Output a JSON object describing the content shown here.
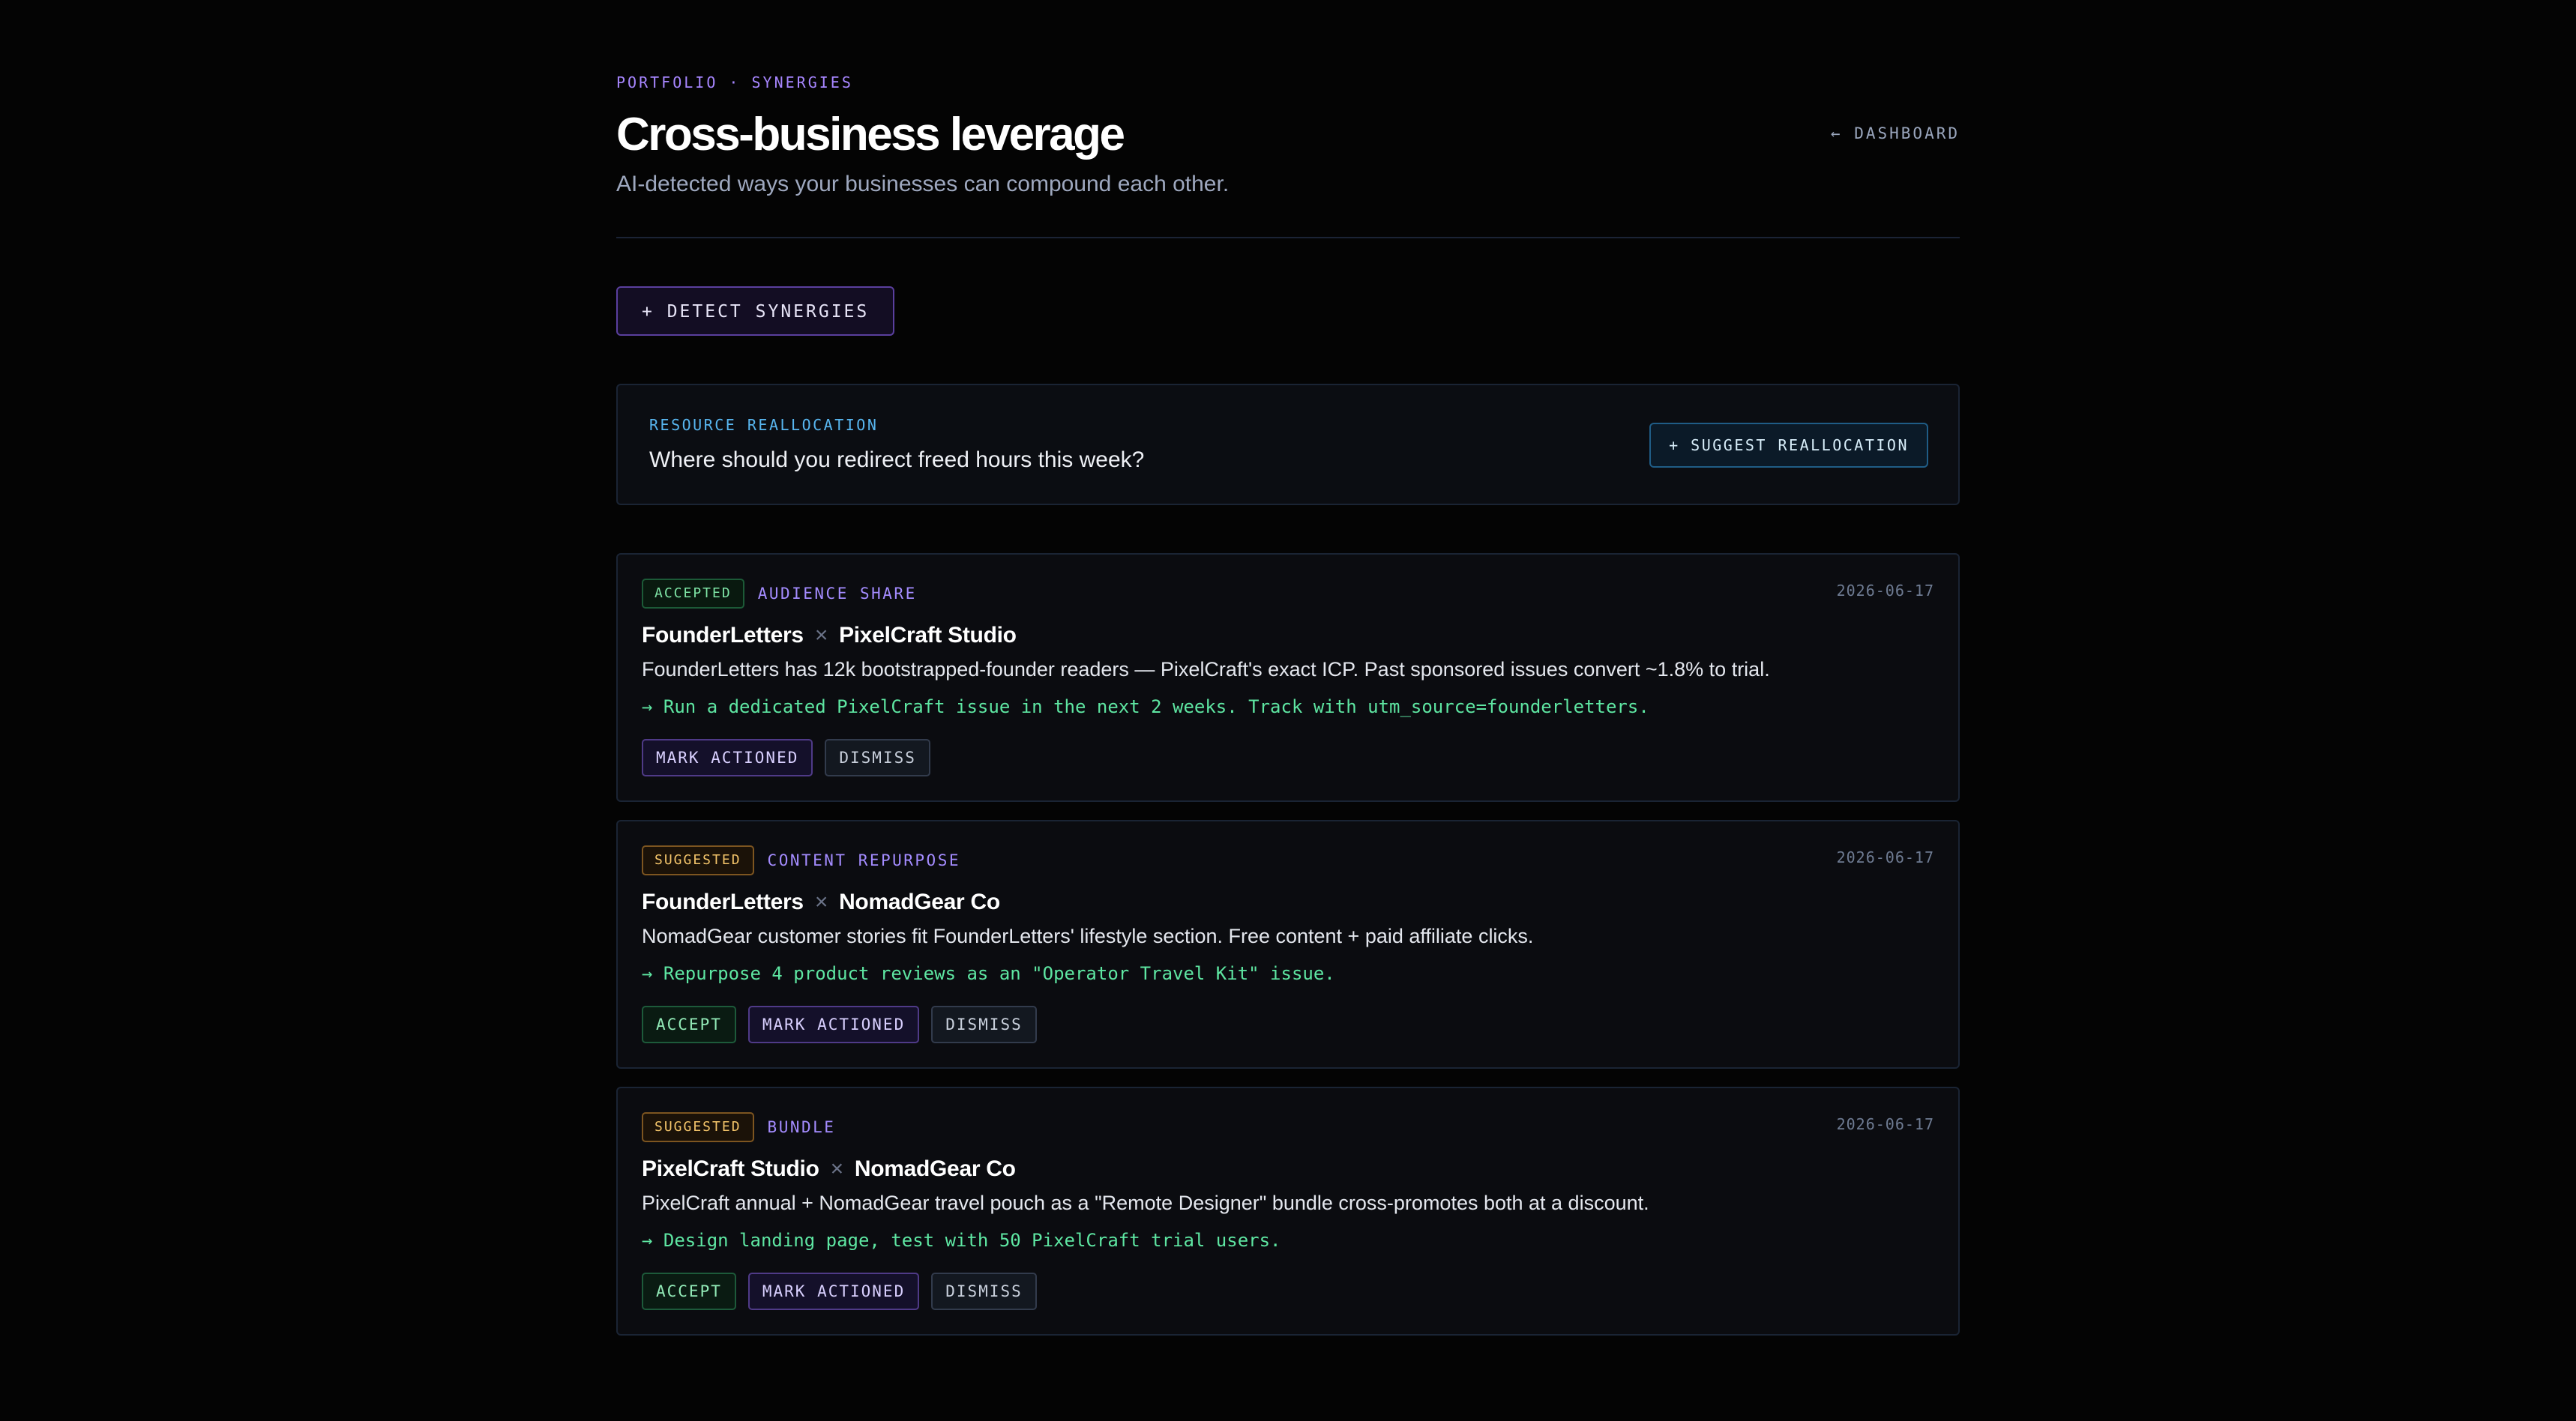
{
  "header": {
    "eyebrow": "PORTFOLIO · SYNERGIES",
    "title": "Cross-business leverage",
    "subtitle": "AI-detected ways your businesses can compound each other.",
    "back_link": "← DASHBOARD"
  },
  "detect_button": "+ DETECT SYNERGIES",
  "reallocation": {
    "label": "RESOURCE REALLOCATION",
    "question": "Where should you redirect freed hours this week?",
    "button": "+ SUGGEST REALLOCATION"
  },
  "synergies": [
    {
      "status": "ACCEPTED",
      "category": "AUDIENCE SHARE",
      "date": "2026-06-17",
      "business_a": "FounderLetters",
      "separator": "×",
      "business_b": "PixelCraft Studio",
      "description": "FounderLetters has 12k bootstrapped-founder readers — PixelCraft's exact ICP. Past sponsored issues convert ~1.8% to trial.",
      "action": "→ Run a dedicated PixelCraft issue in the next 2 weeks. Track with utm_source=founderletters.",
      "buttons": {
        "mark_actioned": "MARK ACTIONED",
        "dismiss": "DISMISS"
      }
    },
    {
      "status": "SUGGESTED",
      "category": "CONTENT REPURPOSE",
      "date": "2026-06-17",
      "business_a": "FounderLetters",
      "separator": "×",
      "business_b": "NomadGear Co",
      "description": "NomadGear customer stories fit FounderLetters' lifestyle section. Free content + paid affiliate clicks.",
      "action": "→ Repurpose 4 product reviews as an \"Operator Travel Kit\" issue.",
      "buttons": {
        "accept": "ACCEPT",
        "mark_actioned": "MARK ACTIONED",
        "dismiss": "DISMISS"
      }
    },
    {
      "status": "SUGGESTED",
      "category": "BUNDLE",
      "date": "2026-06-17",
      "business_a": "PixelCraft Studio",
      "separator": "×",
      "business_b": "NomadGear Co",
      "description": "PixelCraft annual + NomadGear travel pouch as a \"Remote Designer\" bundle cross-promotes both at a discount.",
      "action": "→ Design landing page, test with 50 PixelCraft trial users.",
      "buttons": {
        "accept": "ACCEPT",
        "mark_actioned": "MARK ACTIONED",
        "dismiss": "DISMISS"
      }
    }
  ],
  "colors": {
    "background": "#040404",
    "accent_purple": "#a786ff",
    "accent_blue": "#58b6f0",
    "accent_green": "#5ee6a2",
    "accent_amber": "#f3c46a"
  }
}
